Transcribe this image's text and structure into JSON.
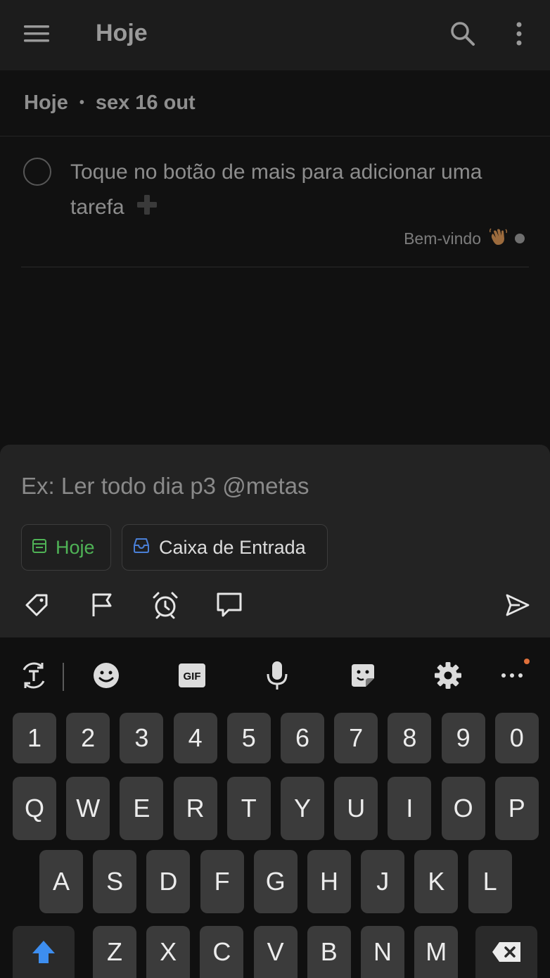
{
  "header": {
    "title": "Hoje",
    "menu_icon": "hamburger-menu-icon",
    "search_icon": "search-icon",
    "more_icon": "more-vertical-icon"
  },
  "section": {
    "label": "Hoje",
    "separator": "•",
    "date": "sex 16 out"
  },
  "task": {
    "text": "Toque no botão de mais para adicionar uma tarefa",
    "project": "Bem-vindo",
    "project_emoji": "waving-hand-icon"
  },
  "quick_add": {
    "placeholder": "Ex: Ler todo dia p3 @metas",
    "chip_today": "Hoje",
    "chip_inbox": "Caixa de Entrada",
    "actions": [
      "label-icon",
      "flag-icon",
      "alarm-icon",
      "comment-icon"
    ],
    "send_icon": "send-icon"
  },
  "keyboard": {
    "toolbar": [
      "translate-icon",
      "emoji-icon",
      "gif-icon",
      "microphone-icon",
      "sticker-icon",
      "settings-icon",
      "more-horizontal-icon"
    ],
    "gif_label": "GIF",
    "rows": [
      [
        "1",
        "2",
        "3",
        "4",
        "5",
        "6",
        "7",
        "8",
        "9",
        "0"
      ],
      [
        "Q",
        "W",
        "E",
        "R",
        "T",
        "Y",
        "U",
        "I",
        "O",
        "P"
      ],
      [
        "A",
        "S",
        "D",
        "F",
        "G",
        "H",
        "J",
        "K",
        "L"
      ],
      [
        "Z",
        "X",
        "C",
        "V",
        "B",
        "N",
        "M"
      ]
    ]
  },
  "colors": {
    "today_green": "#4fb356",
    "inbox_blue": "#4a7fd6",
    "shift_blue": "#3d8ef0",
    "notification_orange": "#e0703a"
  }
}
